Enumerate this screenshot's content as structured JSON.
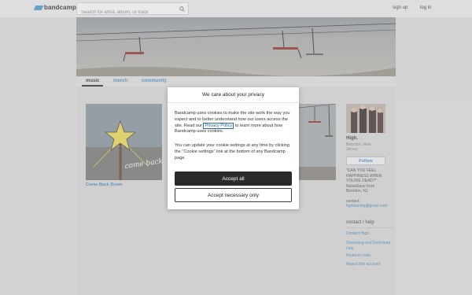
{
  "topbar": {
    "logo_text": "bandcamp",
    "search_placeholder": "Search for artist, album, or track",
    "signup_label": "sign up",
    "login_label": "log in"
  },
  "nav": {
    "tabs": [
      {
        "label": "music"
      },
      {
        "label": "merch"
      },
      {
        "label": "community"
      }
    ]
  },
  "album": {
    "title": "Come Back Down"
  },
  "sidebar": {
    "band_name": "High.",
    "location": "Boonton, New Jersey",
    "follow_label": "Follow",
    "bio": "\"CAN YOU FEEL HAPPINESS WHEN YOU'RE DEAD?\" NoiseGaze from Boonton, NJ",
    "contact_label": "contact:",
    "contact_email": "highbandnj@gmail.com",
    "help_heading": "contact / help",
    "links": [
      {
        "label": "Contact High."
      },
      {
        "label": "Streaming and Download help"
      },
      {
        "label": "Redeem code"
      },
      {
        "label": "Report this account"
      }
    ]
  },
  "cookie_modal": {
    "title": "We care about your privacy",
    "p1_before": "Bandcamp uses cookies to make the site work the way you expect and to better understand how our users access the site. Read our ",
    "privacy_link": "Privacy Policy",
    "p1_after": " to learn more about how Bandcamp uses cookies.",
    "p2": "You can update your cookie settings at any time by clicking the \"Cookie settings\" link at the bottom of any Bandcamp page.",
    "accept_all_label": "Accept all",
    "accept_necessary_label": "Accept necessary only"
  },
  "colors": {
    "accent": "#3d7fb5",
    "logo": "#3d8ec9",
    "accept_button": "#2b2b2b"
  }
}
